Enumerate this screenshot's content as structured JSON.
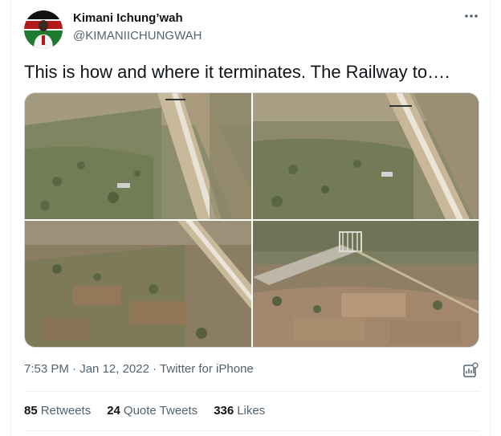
{
  "author": {
    "name": "Kimani Ichung’wah",
    "handle": "@KIMANIICHUNGWAH"
  },
  "more_icon": "ellipsis-icon",
  "tweet": {
    "text": "This is how and where it terminates. The Railway to…."
  },
  "media": [
    {
      "alt": "aerial-railway-photo-1"
    },
    {
      "alt": "aerial-railway-photo-2"
    },
    {
      "alt": "aerial-railway-photo-3"
    },
    {
      "alt": "aerial-railway-photo-4"
    }
  ],
  "meta": {
    "time": "7:53 PM",
    "separator": "·",
    "date": "Jan 12, 2022",
    "source": "Twitter for iPhone"
  },
  "stats": {
    "retweets_count": "85",
    "retweets_label": "Retweets",
    "quotes_count": "24",
    "quotes_label": "Quote Tweets",
    "likes_count": "336",
    "likes_label": "Likes"
  },
  "colors": {
    "text": "#0f1419",
    "secondary": "#536471",
    "border": "#cfd9de"
  }
}
